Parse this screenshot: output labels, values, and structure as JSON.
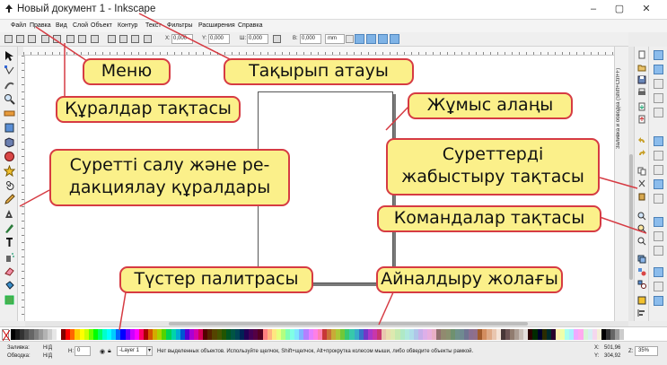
{
  "window": {
    "title": "Новый документ 1 - Inkscape",
    "controls": [
      "–",
      "▢",
      "✕"
    ]
  },
  "menubar": [
    "Файл",
    "Правка",
    "Вид",
    "Слой",
    "Объект",
    "Контур",
    "Текст",
    "Фильтры",
    "Расширения",
    "Справка"
  ],
  "tool_controls": {
    "x_label": "X:",
    "x_value": "0,000",
    "y_label": "Y:",
    "y_value": "0,000",
    "w_label": "Ш:",
    "w_value": "0,000",
    "h_label": "В:",
    "h_value": "0,000",
    "unit": "mm"
  },
  "dock_tab": "Заливка и обводка (Shift+Ctrl+F)",
  "status": {
    "fill_label": "Заливка:",
    "fill_value": "Н/Д",
    "stroke_label": "Обводка:",
    "stroke_value": "Н/Д",
    "h_label": "H:",
    "h_value": "0",
    "layer": "-Layer 1",
    "message": "Нет выделенных объектов. Используйте щелчок, Shift+щелчок, Alt+прокрутка колесом мыши, либо обведите объекты рамкой.",
    "x_label": "X:",
    "x_value": "501,96",
    "y_label": "Y:",
    "y_value": "304,92",
    "z_label": "Z:",
    "zoom": "35%"
  },
  "palette_colors": [
    "#000000",
    "#1a1a1a",
    "#333333",
    "#4d4d4d",
    "#666666",
    "#808080",
    "#999999",
    "#b3b3b3",
    "#cccccc",
    "#e6e6e6",
    "#ffffff",
    "#800000",
    "#ff0000",
    "#ff6600",
    "#ffcc00",
    "#ffff00",
    "#ccff00",
    "#66ff00",
    "#00ff00",
    "#00ff66",
    "#00ffcc",
    "#00ffff",
    "#00ccff",
    "#0066ff",
    "#0000ff",
    "#6600ff",
    "#cc00ff",
    "#ff00ff",
    "#ff0066",
    "#aa0000",
    "#d45500",
    "#d4aa00",
    "#aad400",
    "#55d400",
    "#00d455",
    "#00d4aa",
    "#00aad4",
    "#0055d4",
    "#5500d4",
    "#aa00d4",
    "#d400aa",
    "#d40055",
    "#550000",
    "#552200",
    "#554400",
    "#445500",
    "#225500",
    "#005522",
    "#005544",
    "#004455",
    "#002255",
    "#220055",
    "#440055",
    "#550044",
    "#550022",
    "#ff8080",
    "#ffb380",
    "#ffe680",
    "#e6ff80",
    "#b3ff80",
    "#80ffb3",
    "#80ffe6",
    "#80e6ff",
    "#80b3ff",
    "#b380ff",
    "#e680ff",
    "#ff80e6",
    "#ff80b3",
    "#c83737",
    "#c87137",
    "#c8ab37",
    "#abc837",
    "#71c837",
    "#37c871",
    "#37c8ab",
    "#37abc8",
    "#3771c8",
    "#7137c8",
    "#ab37c8",
    "#c837ab",
    "#c83771",
    "#e9c6af",
    "#e9ddaf",
    "#dde9af",
    "#c6e9af",
    "#afe9c6",
    "#afe9dd",
    "#afdde9",
    "#afc6e9",
    "#c6afe9",
    "#ddafe9",
    "#e9afdd",
    "#e9afc6",
    "#916f6f",
    "#918a6f",
    "#8a916f",
    "#6f916f",
    "#6f918a",
    "#6f8a91",
    "#6f7491",
    "#8a6f91",
    "#916f8a",
    "#a05a2c",
    "#d38d5f",
    "#deaa87",
    "#e9c6af",
    "#f4e3d7",
    "#483737",
    "#6c5353",
    "#917c6f",
    "#ac9d93",
    "#c8beb7",
    "#e3dedb",
    "#2b0000",
    "#002b00",
    "#00002b",
    "#2b2b00",
    "#002b2b",
    "#2b002b",
    "#ffeeaa",
    "#eeffaa",
    "#aaffee",
    "#aaeeff",
    "#eeaaff",
    "#ffaaee",
    "#d7f4d7",
    "#d7eef4",
    "#f4d7ee",
    "#f4eed7",
    "#000000",
    "#333333",
    "#666666",
    "#999999",
    "#cccccc",
    "#ffffff"
  ],
  "callouts": {
    "menu": "Меню",
    "title": "Тақырып атауы",
    "toolbar": "Құралдар тақтасы",
    "workspace": "Жұмыс алаңы",
    "drawing_tools": "Суретті салу және ре-дакциялау құралдары",
    "snap_bar": "Суреттерді жабыстыру тақтасы",
    "command_bar": "Командалар тақтасы",
    "palette": "Түстер палитрасы",
    "scrollbar": "Айналдыру жолағы"
  },
  "colors": {
    "callout_fill": "#fbf08a",
    "callout_border": "#d63b43",
    "snap_active": "#8bbcec"
  }
}
